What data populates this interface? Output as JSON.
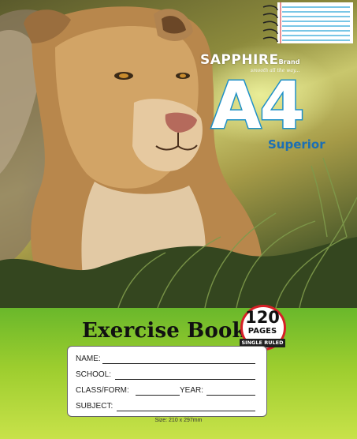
{
  "brand": {
    "name": "SAPPHIRE",
    "suffix": "Brand",
    "tagline": "smooth all the way..."
  },
  "cover": {
    "size": "A4",
    "grade": "Superior",
    "title": "Exercise Book",
    "pages_count": "120",
    "pages_word": "PAGES",
    "ruling": "SINGLE RULED",
    "size_note": "Size: 210 x 297mm"
  },
  "form": {
    "name_label": "NAME:",
    "school_label": "SCHOOL:",
    "class_label": "CLASS/FORM:",
    "year_label": "YEAR:",
    "subject_label": "SUBJECT:"
  },
  "colors": {
    "accent_blue": "#1e90c8",
    "panel_green": "#7cc02b",
    "badge_red": "#d62027"
  }
}
